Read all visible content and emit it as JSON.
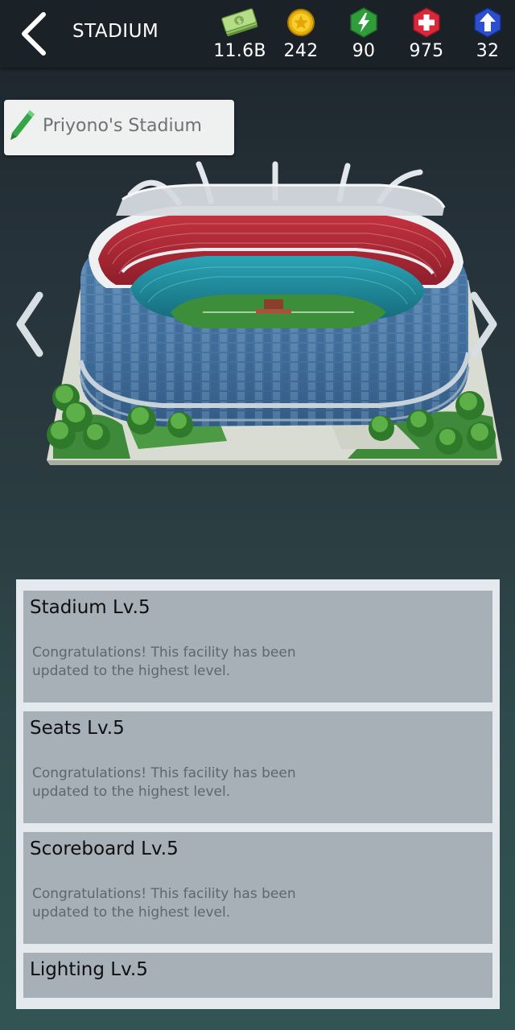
{
  "header": {
    "title": "STADIUM",
    "resources": [
      {
        "icon": "money-icon",
        "value": "11.6B"
      },
      {
        "icon": "gold-coin-icon",
        "value": "242"
      },
      {
        "icon": "energy-icon",
        "value": "90"
      },
      {
        "icon": "medical-icon",
        "value": "975"
      },
      {
        "icon": "upgrade-arrow-icon",
        "value": "32"
      }
    ]
  },
  "stadium": {
    "name": "Priyono's Stadium"
  },
  "facilities": [
    {
      "title": "Stadium Lv.5",
      "message": "Congratulations! This facility has been updated to the highest level."
    },
    {
      "title": "Seats Lv.5",
      "message": "Congratulations! This facility has been updated to the highest level."
    },
    {
      "title": "Scoreboard Lv.5",
      "message": "Congratulations! This facility has been updated to the highest level."
    },
    {
      "title": "Lighting Lv.5"
    }
  ],
  "colors": {
    "topbar": "#1a2127",
    "card": "#a7afb7",
    "panel": "#e3e9ec",
    "seat_red": "#b3283a",
    "seat_teal": "#1f8fa0",
    "facade_blue": "#4b7aa6"
  }
}
